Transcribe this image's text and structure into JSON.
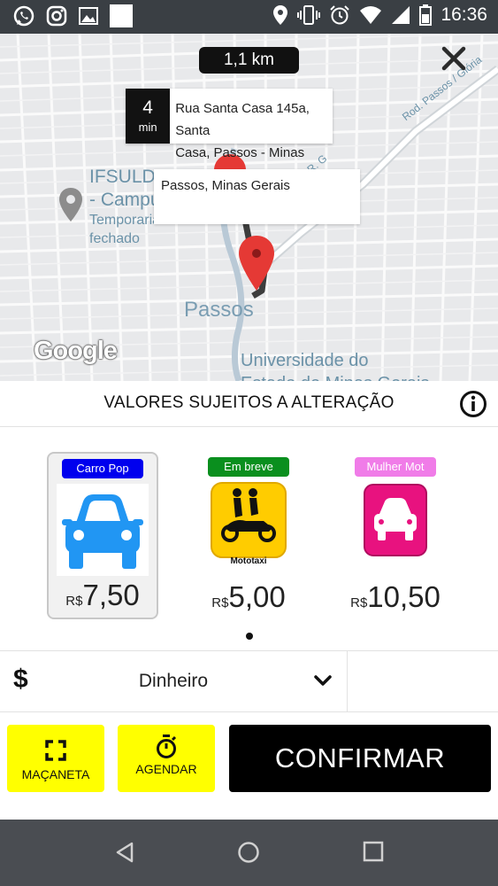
{
  "status_bar": {
    "time": "16:36",
    "left_icons": [
      "whatsapp-icon",
      "instagram-icon",
      "gallery-icon",
      "blank-notification-icon"
    ],
    "right_icons": [
      "location-icon",
      "vibrate-icon",
      "alarm-icon",
      "wifi-icon",
      "signal-icon",
      "battery-icon"
    ]
  },
  "map": {
    "distance": "1,1 km",
    "route_minutes": "4",
    "route_minutes_unit": "min",
    "origin_address_line1": "Rua Santa Casa 145a, Santa",
    "origin_address_line2": "Casa, Passos - Minas",
    "destination": "Passos, Minas Gerais",
    "labels": {
      "ifsuld_line1": "IFSULD",
      "ifsuld_line2": "- Campu",
      "ifsuld_line3": "Temporariamente",
      "ifsuld_line4": "fechado",
      "city": "Passos",
      "university": "Universidade do",
      "road": "Rod. Passos / Glória",
      "street_fragment": "R. G",
      "bottom_fragment": "Estado de Minas Gerais"
    },
    "attribution": "Google"
  },
  "notice": {
    "text": "VALORES SUJEITOS A ALTERAÇÃO"
  },
  "vehicles": [
    {
      "badge": "Carro Pop",
      "badge_color": "#0000ee",
      "currency": "R$",
      "price": "7,50",
      "icon": "car-blue-icon",
      "selected": true
    },
    {
      "badge": "Em breve",
      "badge_color": "#0a8f1e",
      "currency": "R$",
      "price": "5,00",
      "icon": "mototaxi-icon",
      "icon_label": "Mototaxi",
      "selected": false
    },
    {
      "badge": "Mulher Mot",
      "badge_color": "#f07ce8",
      "currency": "R$",
      "price": "10,50",
      "icon": "car-pink-icon",
      "selected": false
    }
  ],
  "payment": {
    "symbol": "$",
    "method": "Dinheiro"
  },
  "actions": {
    "macaneta": "MAÇANETA",
    "agendar": "AGENDAR",
    "confirm": "CONFIRMAR"
  },
  "colors": {
    "accent_yellow": "#ffff00",
    "confirm_bg": "#000000",
    "map_pin": "#e53935",
    "route": "#3d3d3d"
  }
}
